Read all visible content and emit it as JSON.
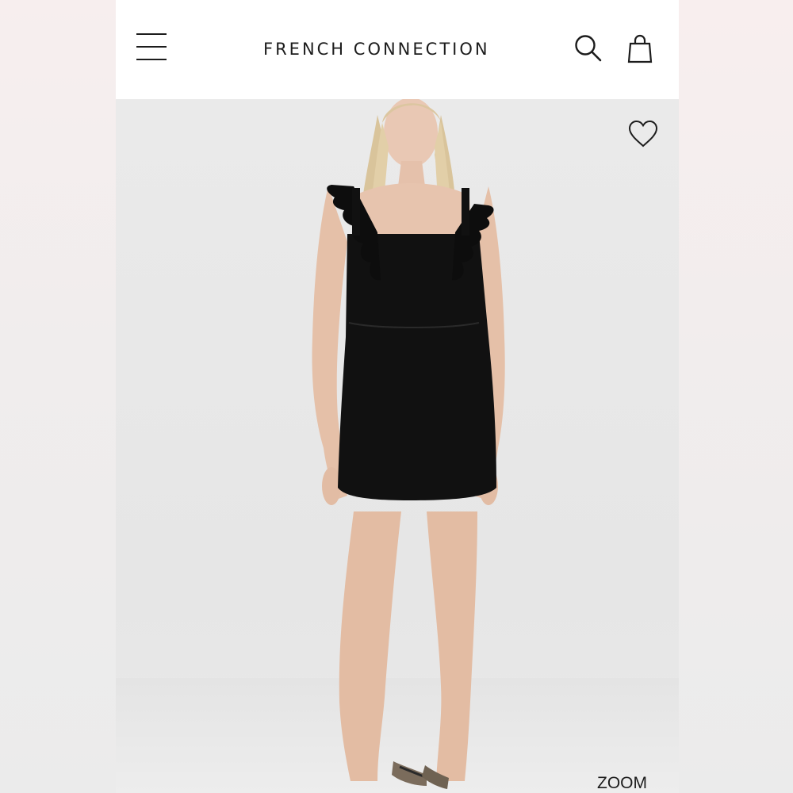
{
  "header": {
    "brand": "FRENCH CONNECTION",
    "menu_icon": "hamburger-menu-icon",
    "search_icon": "search-icon",
    "cart_icon": "shopping-bag-icon"
  },
  "product_image": {
    "wishlist_icon": "heart-outline-icon",
    "zoom_label": "ZOOM"
  },
  "colors": {
    "header_bg": "#ffffff",
    "text": "#1c1c1c",
    "image_bg": "#ebebeb",
    "dress": "#111111"
  }
}
